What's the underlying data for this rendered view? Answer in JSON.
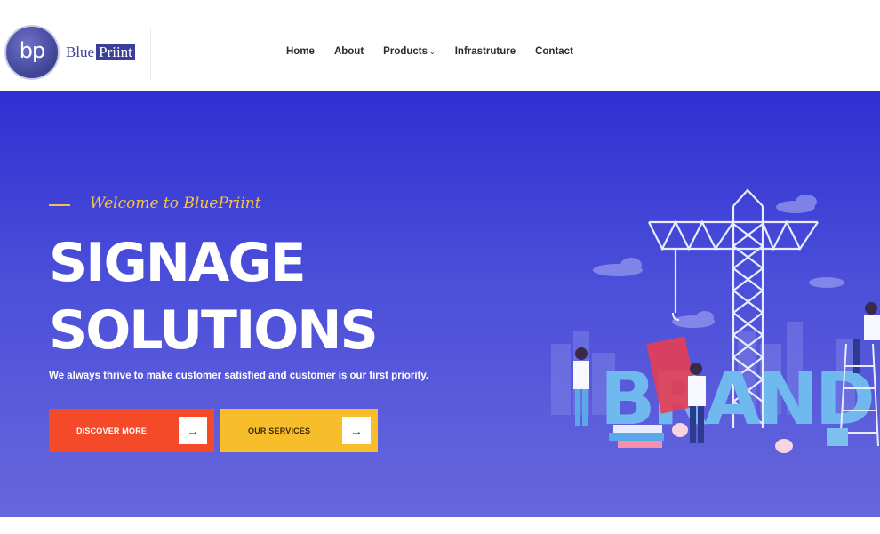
{
  "brand": {
    "logo_mark": "bp",
    "name_part1": "Blue",
    "name_part2": "Priint"
  },
  "nav": {
    "items": [
      {
        "label": "Home"
      },
      {
        "label": "About"
      },
      {
        "label": "Products",
        "has_dropdown": true
      },
      {
        "label": "Infrastruture"
      },
      {
        "label": "Contact"
      }
    ]
  },
  "hero": {
    "welcome": "Welcome to BluePriint",
    "title_line1": "SIGNAGE",
    "title_line2": "SOLUTIONS",
    "subtitle": "We always thrive to make customer satisfied and customer is our first priority.",
    "illustration_word": "BRAND",
    "buttons": {
      "discover": "DISCOVER MORE",
      "services": "OUR SERVICES"
    }
  },
  "colors": {
    "hero_top": "#2f30d1",
    "hero_bottom": "#6767dc",
    "accent_red": "#f44a2a",
    "accent_yellow": "#f7bd2a",
    "welcome_text": "#f5c542"
  },
  "icons": {
    "arrow": "arrow-right-icon",
    "dropdown": "chevron-down-icon"
  }
}
